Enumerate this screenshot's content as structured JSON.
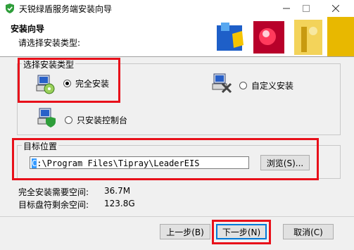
{
  "window": {
    "title": "天锐绿盾服务端安装向导",
    "icons": {
      "app": "shield-icon",
      "minimize": "minimize-icon",
      "maximize": "maximize-icon",
      "close": "close-icon"
    }
  },
  "header": {
    "title": "安装向导",
    "subtitle": "请选择安装类型:"
  },
  "install_type": {
    "group_label": "选择安装类型",
    "options": [
      {
        "label": "完全安装",
        "selected": true,
        "icon": "computer-cd-icon"
      },
      {
        "label": "自定义安装",
        "selected": false,
        "icon": "computer-tools-icon"
      },
      {
        "label": "只安装控制台",
        "selected": false,
        "icon": "computer-shield-icon"
      }
    ]
  },
  "target": {
    "group_label": "目标位置",
    "path_first": "C",
    "path_rest": ":\\Program Files\\Tipray\\LeaderEIS",
    "browse_label": "浏览(S)..."
  },
  "space": {
    "required_label": "完全安装需要空间:",
    "required_value": "36.7M",
    "free_label": "目标盘符剩余空间:",
    "free_value": "123.8G"
  },
  "buttons": {
    "back": "上一步(B)",
    "next": "下一步(N)",
    "cancel": "取消(C)"
  },
  "colors": {
    "highlight": "#e8101a",
    "selection": "#3399ff"
  }
}
